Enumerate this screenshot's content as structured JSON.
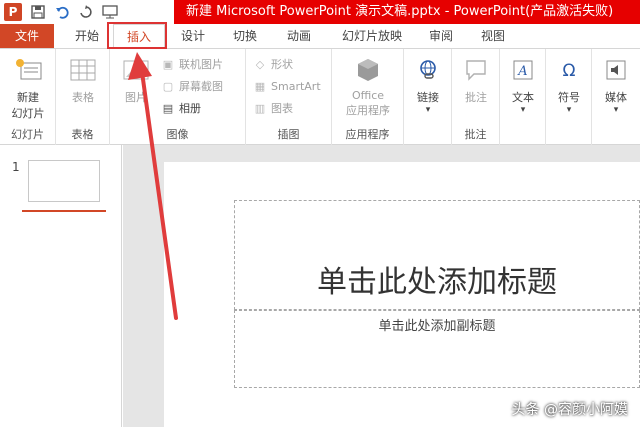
{
  "window": {
    "title": "新建 Microsoft PowerPoint 演示文稿.pptx - PowerPoint(产品激活失败)",
    "title_bar_color": "#e60000"
  },
  "quick_access": {
    "logo": "P",
    "icons": [
      "powerpoint-logo-icon",
      "save-icon",
      "undo-icon",
      "redo-icon",
      "present-icon"
    ]
  },
  "tabs": [
    {
      "label": "文件"
    },
    {
      "label": "开始"
    },
    {
      "label": "插入"
    },
    {
      "label": "设计"
    },
    {
      "label": "切换"
    },
    {
      "label": "动画"
    },
    {
      "label": "幻灯片放映"
    },
    {
      "label": "审阅"
    },
    {
      "label": "视图"
    }
  ],
  "active_tab": "插入",
  "accent_color": "#d24726",
  "ribbon": {
    "slides": {
      "new_slide_line1": "新建",
      "new_slide_line2": "幻灯片",
      "group": "幻灯片"
    },
    "tables": {
      "table": "表格",
      "group": "表格"
    },
    "images": {
      "picture": "图片",
      "online_pictures": "联机图片",
      "screenshot": "屏幕截图",
      "album": "相册",
      "group": "图像"
    },
    "illustrations": {
      "shapes": "形状",
      "smartart": "SmartArt",
      "chart": "图表",
      "group": "插图"
    },
    "apps": {
      "office_line1": "Office",
      "office_line2": "应用程序",
      "group": "应用程序"
    },
    "links": {
      "link": "链接"
    },
    "comments": {
      "comment": "批注",
      "group": "批注"
    },
    "text": {
      "text": "文本"
    },
    "symbols": {
      "symbol": "符号"
    },
    "media": {
      "media": "媒体"
    }
  },
  "slide_pane": {
    "slide_number": "1"
  },
  "slide": {
    "title_placeholder": "单击此处添加标题",
    "subtitle_placeholder": "单击此处添加副标题"
  },
  "watermark": "头条 @容颜小阿嫫",
  "annotation_arrow_color": "#e03c3c"
}
